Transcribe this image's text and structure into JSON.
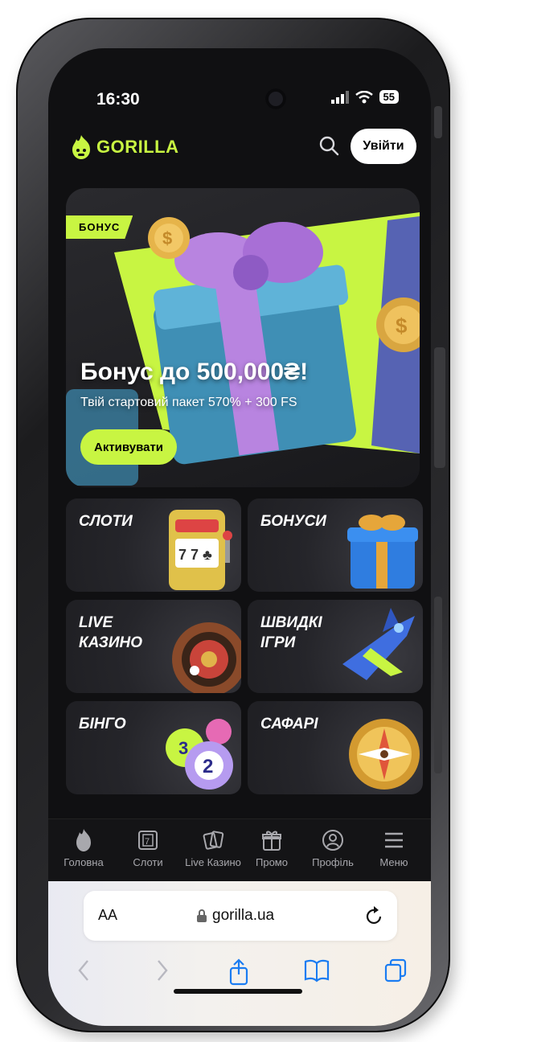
{
  "status": {
    "time": "16:30",
    "battery": "55"
  },
  "header": {
    "logo": "GORILLA",
    "login_label": "Увійти"
  },
  "banner": {
    "tag": "БОНУС",
    "title": "Бонус до 500,000₴!",
    "subtitle": "Твій стартовий пакет 570% + 300 FS",
    "cta": "Активувати"
  },
  "categories": [
    {
      "label": "СЛОТИ"
    },
    {
      "label": "БОНУСИ"
    },
    {
      "label": "LIVE\nКАЗИНО"
    },
    {
      "label": "ШВИДКІ\nІГРИ"
    },
    {
      "label": "БІНГО"
    },
    {
      "label": "САФАРІ"
    }
  ],
  "tabs": [
    {
      "label": "Головна",
      "icon": "gorilla-icon"
    },
    {
      "label": "Слоти",
      "icon": "slot-icon"
    },
    {
      "label": "Live Казино",
      "icon": "cards-icon"
    },
    {
      "label": "Промо",
      "icon": "gift-icon"
    },
    {
      "label": "Профіль",
      "icon": "profile-icon"
    },
    {
      "label": "Меню",
      "icon": "menu-icon"
    }
  ],
  "browser": {
    "aa": "AA",
    "url": "gorilla.ua"
  },
  "colors": {
    "accent": "#c8f542",
    "background": "#101012"
  }
}
